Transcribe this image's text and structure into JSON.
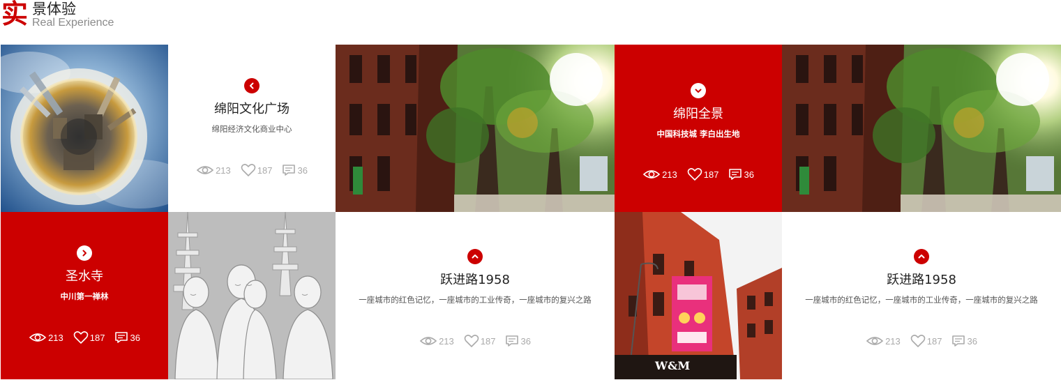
{
  "header": {
    "logo_char": "实",
    "title_cn": "景体验",
    "title_en": "Real Experience"
  },
  "cards": [
    {
      "title": "绵阳文化广场",
      "subtitle": "绵阳经济文化商业中心",
      "arrow": "chevron-left-icon",
      "views": "213",
      "likes": "187",
      "comments": "36"
    },
    {
      "title": "绵阳全景",
      "subtitle": "中国科技城 李白出生地",
      "arrow": "chevron-down-icon",
      "views": "213",
      "likes": "187",
      "comments": "36"
    },
    {
      "title": "圣水寺",
      "subtitle": "中川第一禅林",
      "arrow": "chevron-right-icon",
      "views": "213",
      "likes": "187",
      "comments": "36"
    },
    {
      "title": "跃进路1958",
      "subtitle": "一座城市的红色记忆，一座城市的工业传奇，一座城市的复兴之路",
      "arrow": "chevron-up-icon",
      "views": "213",
      "likes": "187",
      "comments": "36"
    },
    {
      "title": "跃进路1958",
      "subtitle": "一座城市的红色记忆，一座城市的工业传奇，一座城市的复兴之路",
      "arrow": "chevron-up-icon",
      "views": "213",
      "likes": "187",
      "comments": "36"
    }
  ],
  "photos": {
    "storefront_sign": "W&M"
  },
  "colors": {
    "accent_red": "#cc0000",
    "muted_gray": "#aaaaaa",
    "text_dark": "#222222"
  }
}
